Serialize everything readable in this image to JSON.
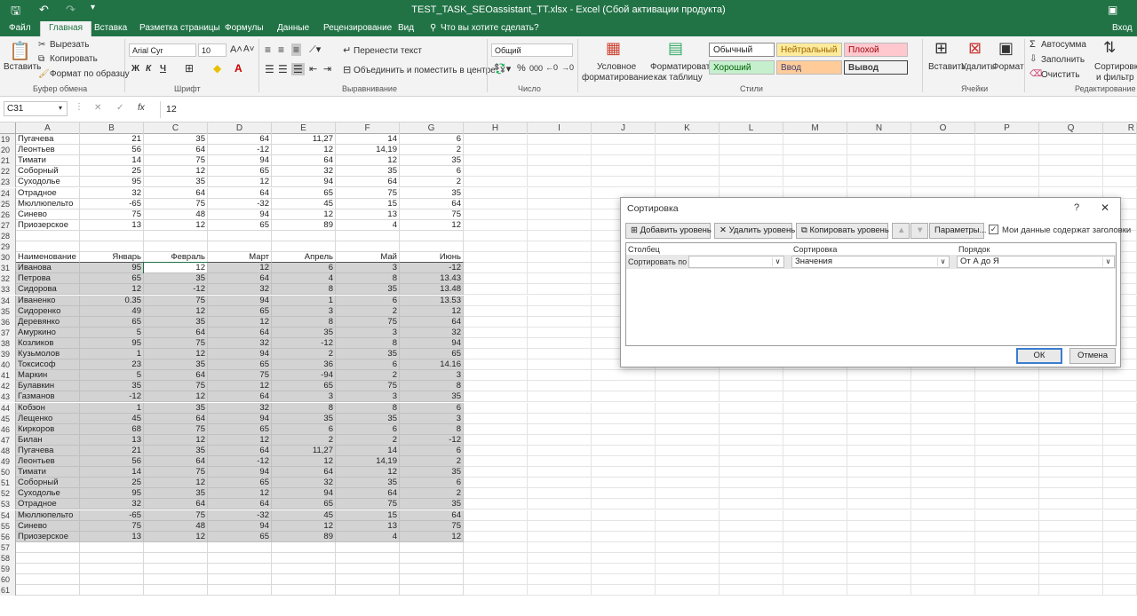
{
  "title": "TEST_TASK_SEOassistant_TT.xlsx - Excel (Сбой активации продукта)",
  "tabs": [
    "Файл",
    "Главная",
    "Вставка",
    "Разметка страницы",
    "Формулы",
    "Данные",
    "Рецензирование",
    "Вид"
  ],
  "tell_me": "Что вы хотите сделать?",
  "signin": "Вход",
  "ribbon": {
    "paste": "Вставить",
    "cut": "Вырезать",
    "copy": "Копировать",
    "format_painter": "Формат по образцу",
    "clipboard": "Буфер обмена",
    "font_name": "Arial Cyr",
    "font_size": "10",
    "font": "Шрифт",
    "bold": "Ж",
    "italic": "К",
    "underline": "Ч",
    "wrap": "Перенести текст",
    "merge": "Объединить и поместить в центре",
    "alignment": "Выравнивание",
    "num_format": "Общий",
    "number": "Число",
    "cond_format": "Условное",
    "cond_format2": "форматирование",
    "format_table": "Форматировать",
    "format_table2": "как таблицу",
    "styles": "Стили",
    "style_normal": "Обычный",
    "style_neutral": "Нейтральный",
    "style_bad": "Плохой",
    "style_good": "Хороший",
    "style_input": "Ввод",
    "style_output": "Вывод",
    "insert": "Вставить",
    "delete": "Удалить",
    "format": "Формат",
    "cells": "Ячейки",
    "autosum": "Автосумма",
    "fill": "Заполнить",
    "clear": "Очистить",
    "sort": "Сортировка",
    "sort2": "и фильтр",
    "editing": "Редактирование"
  },
  "namebox": "C31",
  "formula": "12",
  "columns": [
    "A",
    "B",
    "C",
    "D",
    "E",
    "F",
    "G",
    "H",
    "I",
    "J",
    "K",
    "L",
    "M",
    "N",
    "O",
    "P",
    "Q",
    "R"
  ],
  "rows": [
    [
      "19",
      "Пугачева",
      "21",
      "35",
      "64",
      "11,27",
      "14",
      "6"
    ],
    [
      "20",
      "Леонтьев",
      "56",
      "64",
      "-12",
      "12",
      "14,19",
      "2"
    ],
    [
      "21",
      "Тимати",
      "14",
      "75",
      "94",
      "64",
      "12",
      "35"
    ],
    [
      "22",
      "Соборный",
      "25",
      "12",
      "65",
      "32",
      "35",
      "6"
    ],
    [
      "23",
      "Суходолье",
      "95",
      "35",
      "12",
      "94",
      "64",
      "2"
    ],
    [
      "24",
      "Отрадное",
      "32",
      "64",
      "64",
      "65",
      "75",
      "35"
    ],
    [
      "25",
      "Мюллюпельто",
      "-65",
      "75",
      "-32",
      "45",
      "15",
      "64"
    ],
    [
      "26",
      "Синево",
      "75",
      "48",
      "94",
      "12",
      "13",
      "75"
    ],
    [
      "27",
      "Приозерское",
      "13",
      "12",
      "65",
      "89",
      "4",
      "12"
    ],
    [
      "28",
      "",
      "",
      "",
      "",
      "",
      "",
      ""
    ],
    [
      "29",
      "",
      "",
      "",
      "",
      "",
      "",
      ""
    ],
    [
      "30",
      "Наименование к",
      "Январь",
      "Февраль",
      "Март",
      "Апрель",
      "Май",
      "Июнь"
    ],
    [
      "31",
      "Иванова",
      "95",
      "12",
      "12",
      "6",
      "3",
      "-12"
    ],
    [
      "32",
      "Петрова",
      "65",
      "35",
      "64",
      "4",
      "8",
      "13.43"
    ],
    [
      "33",
      "Сидорова",
      "12",
      "-12",
      "32",
      "8",
      "35",
      "13.48"
    ],
    [
      "34",
      "Иваненко",
      "0.35",
      "75",
      "94",
      "1",
      "6",
      "13.53"
    ],
    [
      "35",
      "Сидоренко",
      "49",
      "12",
      "65",
      "3",
      "2",
      "12"
    ],
    [
      "36",
      "Деревянко",
      "65",
      "35",
      "12",
      "8",
      "75",
      "64"
    ],
    [
      "37",
      "Амуркино",
      "5",
      "64",
      "64",
      "35",
      "3",
      "32"
    ],
    [
      "38",
      "Козликов",
      "95",
      "75",
      "32",
      "-12",
      "8",
      "94"
    ],
    [
      "39",
      "Кузьмолов",
      "1",
      "12",
      "94",
      "2",
      "35",
      "65"
    ],
    [
      "40",
      "Токсисоф",
      "23",
      "35",
      "65",
      "36",
      "6",
      "14.16"
    ],
    [
      "41",
      "Маркин",
      "5",
      "64",
      "75",
      "-94",
      "2",
      "3"
    ],
    [
      "42",
      "Булавкин",
      "35",
      "75",
      "12",
      "65",
      "75",
      "8"
    ],
    [
      "43",
      "Газманов",
      "-12",
      "12",
      "64",
      "3",
      "3",
      "35"
    ],
    [
      "44",
      "Кобзон",
      "1",
      "35",
      "32",
      "8",
      "8",
      "6"
    ],
    [
      "45",
      "Лещенко",
      "45",
      "64",
      "94",
      "35",
      "35",
      "3"
    ],
    [
      "46",
      "Киркоров",
      "68",
      "75",
      "65",
      "6",
      "6",
      "8"
    ],
    [
      "47",
      "Билан",
      "13",
      "12",
      "12",
      "2",
      "2",
      "-12"
    ],
    [
      "48",
      "Пугачева",
      "21",
      "35",
      "64",
      "11,27",
      "14",
      "6"
    ],
    [
      "49",
      "Леонтьев",
      "56",
      "64",
      "-12",
      "12",
      "14,19",
      "2"
    ],
    [
      "50",
      "Тимати",
      "14",
      "75",
      "94",
      "64",
      "12",
      "35"
    ],
    [
      "51",
      "Соборный",
      "25",
      "12",
      "65",
      "32",
      "35",
      "6"
    ],
    [
      "52",
      "Суходолье",
      "95",
      "35",
      "12",
      "94",
      "64",
      "2"
    ],
    [
      "53",
      "Отрадное",
      "32",
      "64",
      "64",
      "65",
      "75",
      "35"
    ],
    [
      "54",
      "Мюллюпельто",
      "-65",
      "75",
      "-32",
      "45",
      "15",
      "64"
    ],
    [
      "55",
      "Синево",
      "75",
      "48",
      "94",
      "12",
      "13",
      "75"
    ],
    [
      "56",
      "Приозерское",
      "13",
      "12",
      "65",
      "89",
      "4",
      "12"
    ],
    [
      "57",
      "",
      "",
      "",
      "",
      "",
      "",
      ""
    ],
    [
      "58",
      "",
      "",
      "",
      "",
      "",
      "",
      ""
    ],
    [
      "59",
      "",
      "",
      "",
      "",
      "",
      "",
      ""
    ],
    [
      "60",
      "",
      "",
      "",
      "",
      "",
      "",
      ""
    ],
    [
      "61",
      "",
      "",
      "",
      "",
      "",
      "",
      ""
    ]
  ],
  "dialog": {
    "title": "Сортировка",
    "help": "?",
    "close": "✕",
    "add_level": "Добавить уровень",
    "delete_level": "Удалить уровень",
    "copy_level": "Копировать уровень",
    "params": "Параметры...",
    "has_headers": "Мои данные содержат заголовки",
    "col_header": "Столбец",
    "sort_header": "Сортировка",
    "order_header": "Порядок",
    "sort_by": "Сортировать по",
    "column_value": "",
    "sort_on": "Значения",
    "order": "От А до Я",
    "ok": "ОК",
    "cancel": "Отмена"
  }
}
